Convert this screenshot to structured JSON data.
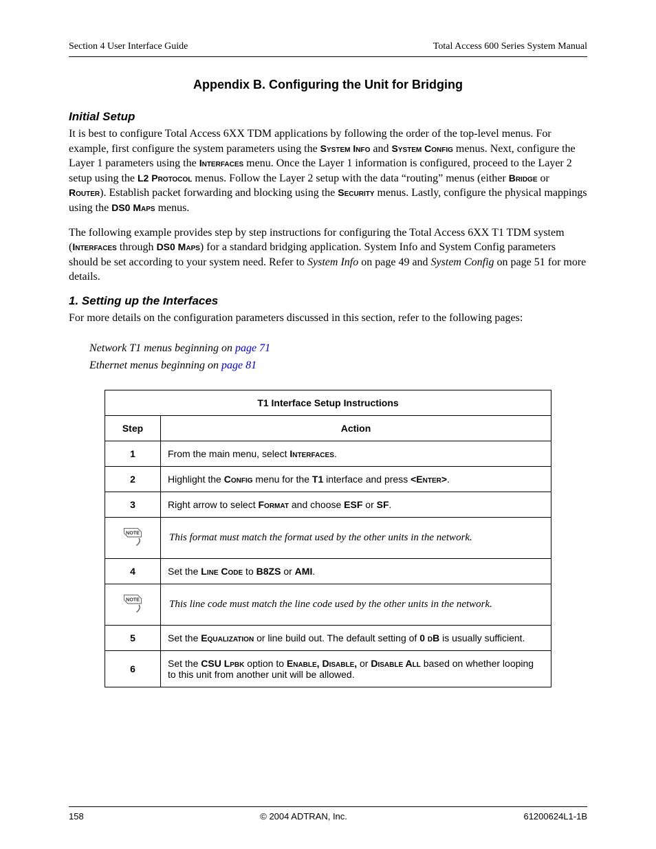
{
  "header": {
    "left": "Section 4  User Interface Guide",
    "right": "Total Access 600 Series System Manual"
  },
  "appendix_title": "Appendix B. Configuring the Unit for Bridging",
  "h_initial": "Initial Setup",
  "p1_a": "It is best to configure Total Access 6XX TDM applications by following the order of the top-level menus. For example, first configure the system parameters using the ",
  "p1_b": " and ",
  "p1_c": " menus. Next, configure the Layer 1 parameters using the ",
  "p1_d": " menu. Once the Layer 1 information is configured, proceed to the Layer 2 setup using the ",
  "p1_e": " menus. Follow the Layer 2 setup with the data “routing” menus (either ",
  "p1_f": " or ",
  "p1_g": "). Establish packet forwarding and blocking using the ",
  "p1_h": " menus. Lastly, configure the physical mappings using the ",
  "p1_i": " menus.",
  "sc": {
    "system_info": "System Info",
    "system_config": "System Config",
    "interfaces": "Interfaces",
    "l2_protocol": "L2 Protocol",
    "bridge": "Bridge",
    "router": "Router",
    "security": "Security",
    "ds0_maps": "DS0 Maps",
    "config": "Config",
    "enter": "<Enter>",
    "format": "Format",
    "line_code": "Line Code",
    "equalization": "Equalization",
    "csu_lpbk": "CSU Lpbk",
    "enable": "Enable,",
    "disable": "Disable,",
    "disable_all": "Disable All"
  },
  "p2_a": "The following example provides step by step instructions for configuring the Total Access 6XX T1 TDM system (",
  "p2_b": " through ",
  "p2_c": ") for a standard bridging application. System Info and System Config parameters should be set according to your system need. Refer to ",
  "p2_sys_info": "System Info",
  "p2_d": " on page 49 and ",
  "p2_sys_config": "System Config",
  "p2_e": " on page 51 for more details.",
  "h_setting": "1. Setting up the Interfaces",
  "p3": "For more details on the configuration parameters discussed in this section, refer to the following pages:",
  "ref1_a": "Network T1 menus beginning on ",
  "ref1_link": "page 71",
  "ref2_a": "Ethernet menus beginning on ",
  "ref2_link": "page 81",
  "table": {
    "title": "T1 Interface Setup Instructions",
    "h_step": "Step",
    "h_action": "Action",
    "rows": {
      "1": {
        "step": "1",
        "a": "From the main menu, select ",
        "b": "."
      },
      "2": {
        "step": "2",
        "a": "Highlight the ",
        "b": " menu for the ",
        "t1": "T1",
        "c": " interface and press ",
        "d": "."
      },
      "3": {
        "step": "3",
        "a": "Right arrow to select ",
        "b": " and choose ",
        "esf": "ESF",
        "c": " or ",
        "sf": "SF",
        "d": "."
      },
      "n1": "This format must match the format used by the other units in the network.",
      "4": {
        "step": "4",
        "a": "Set the ",
        "b": " to ",
        "b8zs": "B8ZS",
        "c": " or ",
        "ami": "AMI",
        "d": "."
      },
      "n2": "This line code must match the line code used by the other units in the network.",
      "5": {
        "step": "5",
        "a": "Set the ",
        "b": " or line build out. The default setting of ",
        "zero": "0 dB",
        "c": " is usually sufficient."
      },
      "6": {
        "step": "6",
        "a": "Set the ",
        "b": " option to ",
        "c": " or ",
        "d": " based on whether looping to this unit from another unit will be allowed."
      }
    }
  },
  "footer": {
    "left": "158",
    "center": "© 2004 ADTRAN, Inc.",
    "right": "61200624L1-1B"
  }
}
